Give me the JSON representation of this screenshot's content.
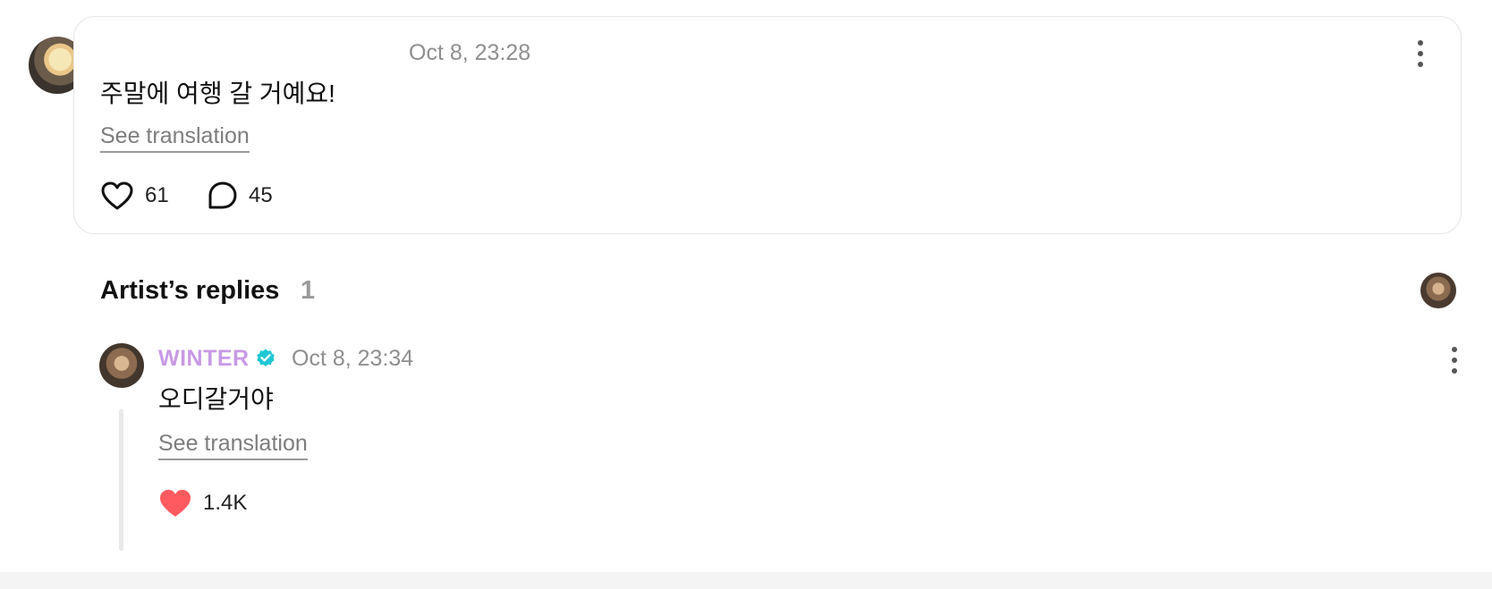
{
  "post": {
    "timestamp": "Oct 8, 23:28",
    "text": "주말에 여행 갈 거예요!",
    "translate_label": "See translation",
    "likes": "61",
    "comments": "45",
    "icons": {
      "like": "heart-outline-icon",
      "comment": "speech-bubble-icon",
      "more": "vertical-dots-icon"
    }
  },
  "replies_section": {
    "title": "Artist’s replies",
    "count": "1"
  },
  "reply": {
    "author": "WINTER",
    "timestamp": "Oct 8, 23:34",
    "text": "오디갈거야",
    "translate_label": "See translation",
    "likes": "1.4K",
    "icons": {
      "verified": "verified-badge-icon",
      "like": "heart-filled-icon",
      "more": "vertical-dots-icon"
    }
  },
  "colors": {
    "artist_name": "#c79ae6",
    "verified_badge": "#1fc7d4",
    "liked_heart": "#ff5a5f",
    "muted_text": "#8f8f8f"
  }
}
